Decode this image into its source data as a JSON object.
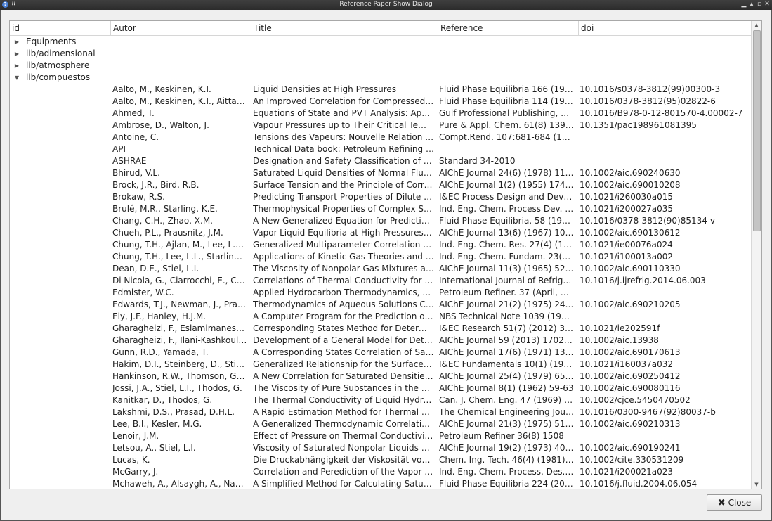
{
  "window": {
    "title": "Reference Paper Show Dialog",
    "app_icon": "?",
    "menu_icon": "⠿",
    "controls": [
      "▁",
      "▴",
      "▫",
      "✕"
    ]
  },
  "table": {
    "headers": [
      "id",
      "Autor",
      "Title",
      "Reference",
      "doi"
    ],
    "groups": [
      {
        "label": "Equipments",
        "expanded": false
      },
      {
        "label": "lib/adimensional",
        "expanded": false
      },
      {
        "label": "lib/atmosphere",
        "expanded": false
      },
      {
        "label": "lib/compuestos",
        "expanded": true
      }
    ],
    "rows": [
      [
        "Aalto, M., Keskinen, K.I.",
        "Liquid Densities at High Pressures",
        "Fluid Phase Equilibria 166 (1999)...",
        "10.1016/s0378-3812(99)00300-3"
      ],
      [
        "Aalto, M., Keskinen, K.I., Aittama...",
        "An Improved Correlation for Compressed Li...",
        "Fluid Phase Equilibria 114 (1996)...",
        "10.1016/0378-3812(95)02822-6"
      ],
      [
        "Ahmed, T.",
        "Equations of State and PVT Analysis: Applica...",
        "Gulf Professional Publishing, 20...",
        "10.1016/B978-0-12-801570-4.00002-7"
      ],
      [
        "Ambrose, D., Walton, J.",
        "Vapour Pressures up to Their Critical Tempe...",
        "Pure & Appl. Chem. 61(8) 1395-1...",
        "10.1351/pac198961081395"
      ],
      [
        "Antoine, C.",
        "Tensions des Vapeurs: Nouvelle Relation Ent...",
        "Compt.Rend. 107:681-684 (1888)",
        ""
      ],
      [
        "API",
        "Technical Data book: Petroleum Refining 6th...",
        "",
        ""
      ],
      [
        "ASHRAE",
        "Designation and Safety Classification of Refr...",
        "Standard 34-2010",
        ""
      ],
      [
        "Bhirud, V.L.",
        "Saturated Liquid Densities of Normal Fluids",
        "AIChE Journal 24(6) (1978) 1127-...",
        "10.1002/aic.690240630"
      ],
      [
        "Brock, J.R., Bird, R.B.",
        "Surface Tension and the Principle of Corresp...",
        "AIChE Journal 1(2) (1955) 174-177",
        "10.1002/aic.690010208"
      ],
      [
        "Brokaw, R.S.",
        "Predicting Transport Properties of Dilute Ga...",
        "I&EC Process Design and Develo...",
        "10.1021/i260030a015"
      ],
      [
        "Brulé, M.R., Starling, K.E.",
        "Thermophysical Properties of Complex Syst...",
        "Ind. Eng. Chem. Process Dev. 23 ...",
        "10.1021/i200027a035"
      ],
      [
        "Chang, C.H., Zhao, X.M.",
        "A New Generalized Equation for Predicting V...",
        "Fluid Phase Equilibria, 58 (1990) ...",
        "10.1016/0378-3812(90)85134-v"
      ],
      [
        "Chueh, P.L., Prausnitz, J.M.",
        "Vapor-Liquid Equilibria at High Pressures: C...",
        "AIChE Journal 13(6) (1967) 1099-...",
        "10.1002/aic.690130612"
      ],
      [
        "Chung, T.H., Ajlan, M., Lee, L.L., S...",
        "Generalized Multiparameter Correlation for ...",
        "Ind. Eng. Chem. Res. 27(4) (1988)...",
        "10.1021/ie00076a024"
      ],
      [
        "Chung, T.H., Lee, L.L., Starling, K.E.",
        "Applications of Kinetic Gas Theories and Mul...",
        "Ind. Eng. Chem. Fundam. 23(1) (...",
        "10.1021/i100013a002"
      ],
      [
        "Dean, D.E., Stiel, L.I.",
        "The Viscosity of Nonpolar Gas Mixtures at M...",
        "AIChE Journal 11(3) (1965) 526-5...",
        "10.1002/aic.690110330"
      ],
      [
        "Di Nicola, G., Ciarrocchi, E., Cocci...",
        "Correlations of Thermal Conductivity for Liq...",
        "International Journal of Refriger...",
        "10.1016/j.ijrefrig.2014.06.003"
      ],
      [
        "Edmister, W.C.",
        "Applied Hydrocarbon Thermodynamics, Par...",
        "Petroleum Refiner. 37 (April, 195...",
        ""
      ],
      [
        "Edwards, T.J., Newman, J., Praus...",
        "Thermodynamics of Aqueous Solutions Con...",
        "AIChE Journal 21(2) (1975) 248-259",
        "10.1002/aic.690210205"
      ],
      [
        "Ely, J.F., Hanley, H.J.M.",
        "A Computer Program for the Prediction of Vi...",
        "NBS Technical Note 1039 (1981)",
        ""
      ],
      [
        "Gharagheizi, F., Eslamimanesh, ...",
        "Corresponding States Method for Determin...",
        "I&EC Research 51(7) (2012) 3179...",
        "10.1021/ie202591f"
      ],
      [
        "Gharagheizi, F., Ilani-Kashkouli, P...",
        "Development of a General Model for Deter...",
        "AIChE Journal 59 (2013) 1702-1708",
        "10.1002/aic.13938"
      ],
      [
        "Gunn, R.D., Yamada, T.",
        "A Corresponding States Correlation of Satur...",
        "AIChE Journal 17(6) (1971) 1341-...",
        "10.1002/aic.690170613"
      ],
      [
        "Hakim, D.I., Steinberg, D., Stiel, L.I.",
        "Generalized Relationship for the Surface Ten...",
        "I&EC Fundamentals 10(1) (1971) ...",
        "10.1021/i160037a032"
      ],
      [
        "Hankinson, R.W., Thomson, G.H.",
        "A New Correlation for Saturated Densities of...",
        "AIChE Journal 25(4) (1979) 653-663",
        "10.1002/aic.690250412"
      ],
      [
        "Jossi, J.A., Stiel, L.I., Thodos, G.",
        "The Viscosity of Pure Substances in the Den...",
        "AIChE Journal 8(1) (1962) 59-63",
        "10.1002/aic.690080116"
      ],
      [
        "Kanitkar, D., Thodos, G.",
        "The Thermal Conductivity of Liquid Hydroca...",
        "Can. J. Chem. Eng. 47 (1969) 427-...",
        "10.1002/cjce.5450470502"
      ],
      [
        "Lakshmi, D.S., Prasad, D.H.L.",
        "A Rapid Estimation Method for Thermal Con...",
        "The Chemical Engineering Journ...",
        "10.1016/0300-9467(92)80037-b"
      ],
      [
        "Lee, B.I., Kesler, M.G.",
        "A Generalized Thermodynamic Correlation ...",
        "AIChE Journal 21(3) (1975) 510-527",
        "10.1002/aic.690210313"
      ],
      [
        "Lenoir, J.M.",
        "Effect of Pressure on Thermal Conductivity o...",
        "Petroleum Refiner 36(8) 1508",
        ""
      ],
      [
        "Letsou, A., Stiel, L.I.",
        "Viscosity of Saturated Nonpolar Liquids at El...",
        "AIChE Journal 19(2) (1973) 409-411",
        "10.1002/aic.690190241"
      ],
      [
        "Lucas, K.",
        "Die Druckabhängigkeit der Viskosität von Fl...",
        "Chem. Ing. Tech. 46(4) (1981) 95...",
        "10.1002/cite.330531209"
      ],
      [
        "McGarry, J.",
        "Correlation and Perediction of the Vapor Pre...",
        "Ind. Eng. Chem. Process. Des. D...",
        "10.1021/i200021a023"
      ],
      [
        "Mchaweh, A., Alsaygh, A., Nasrif...",
        "A Simplified Method for Calculating Saturate...",
        "Fluid Phase Equilibria 224 (2004)...",
        "10.1016/j.fluid.2004.06.054"
      ]
    ]
  },
  "close_button": {
    "label": "Close",
    "icon": "close-icon"
  },
  "colors": {
    "titlebar": "#2f2f2f",
    "background": "#efefef",
    "table_bg": "#ffffff"
  }
}
